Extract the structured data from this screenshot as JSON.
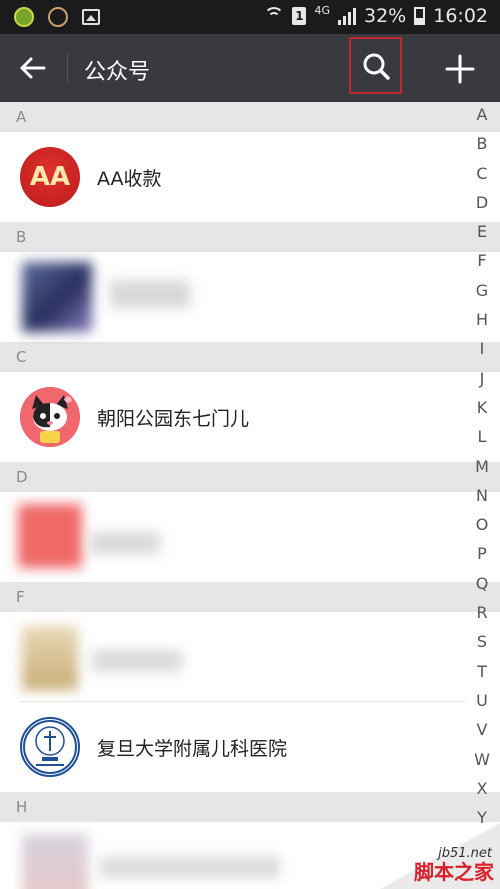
{
  "status_bar": {
    "battery": "32%",
    "time": "16:02",
    "network": "4G",
    "sim_slot": "1",
    "left_icons": [
      "app-icon",
      "emoji-app-icon",
      "gallery-icon"
    ]
  },
  "title_bar": {
    "title": "公众号",
    "back_icon": "arrow-left-icon",
    "search_icon": "search-icon",
    "add_icon": "plus-icon"
  },
  "sections": [
    {
      "letter": "A",
      "items": [
        {
          "name": "AA收款",
          "avatar_text": "AA"
        }
      ]
    },
    {
      "letter": "B",
      "items": [
        {
          "name": ""
        }
      ]
    },
    {
      "letter": "C",
      "items": [
        {
          "name": "朝阳公园东七门儿"
        }
      ]
    },
    {
      "letter": "D",
      "items": [
        {
          "name": ""
        }
      ]
    },
    {
      "letter": "F",
      "items": [
        {
          "name": ""
        },
        {
          "name": "复旦大学附属儿科医院"
        }
      ]
    },
    {
      "letter": "H",
      "items": [
        {
          "name": ""
        }
      ]
    }
  ],
  "index_letters": [
    "A",
    "B",
    "C",
    "D",
    "E",
    "F",
    "G",
    "H",
    "I",
    "J",
    "K",
    "L",
    "M",
    "N",
    "O",
    "P",
    "Q",
    "R",
    "S",
    "T",
    "U",
    "V",
    "W",
    "X",
    "Y"
  ],
  "watermark": {
    "site": "jb51.net",
    "text": "脚本之家"
  },
  "colors": {
    "status_bar": "#1b1b1d",
    "title_bar": "#393a3f",
    "section_header": "#e6e6e6",
    "highlight_box": "#c0272d"
  }
}
